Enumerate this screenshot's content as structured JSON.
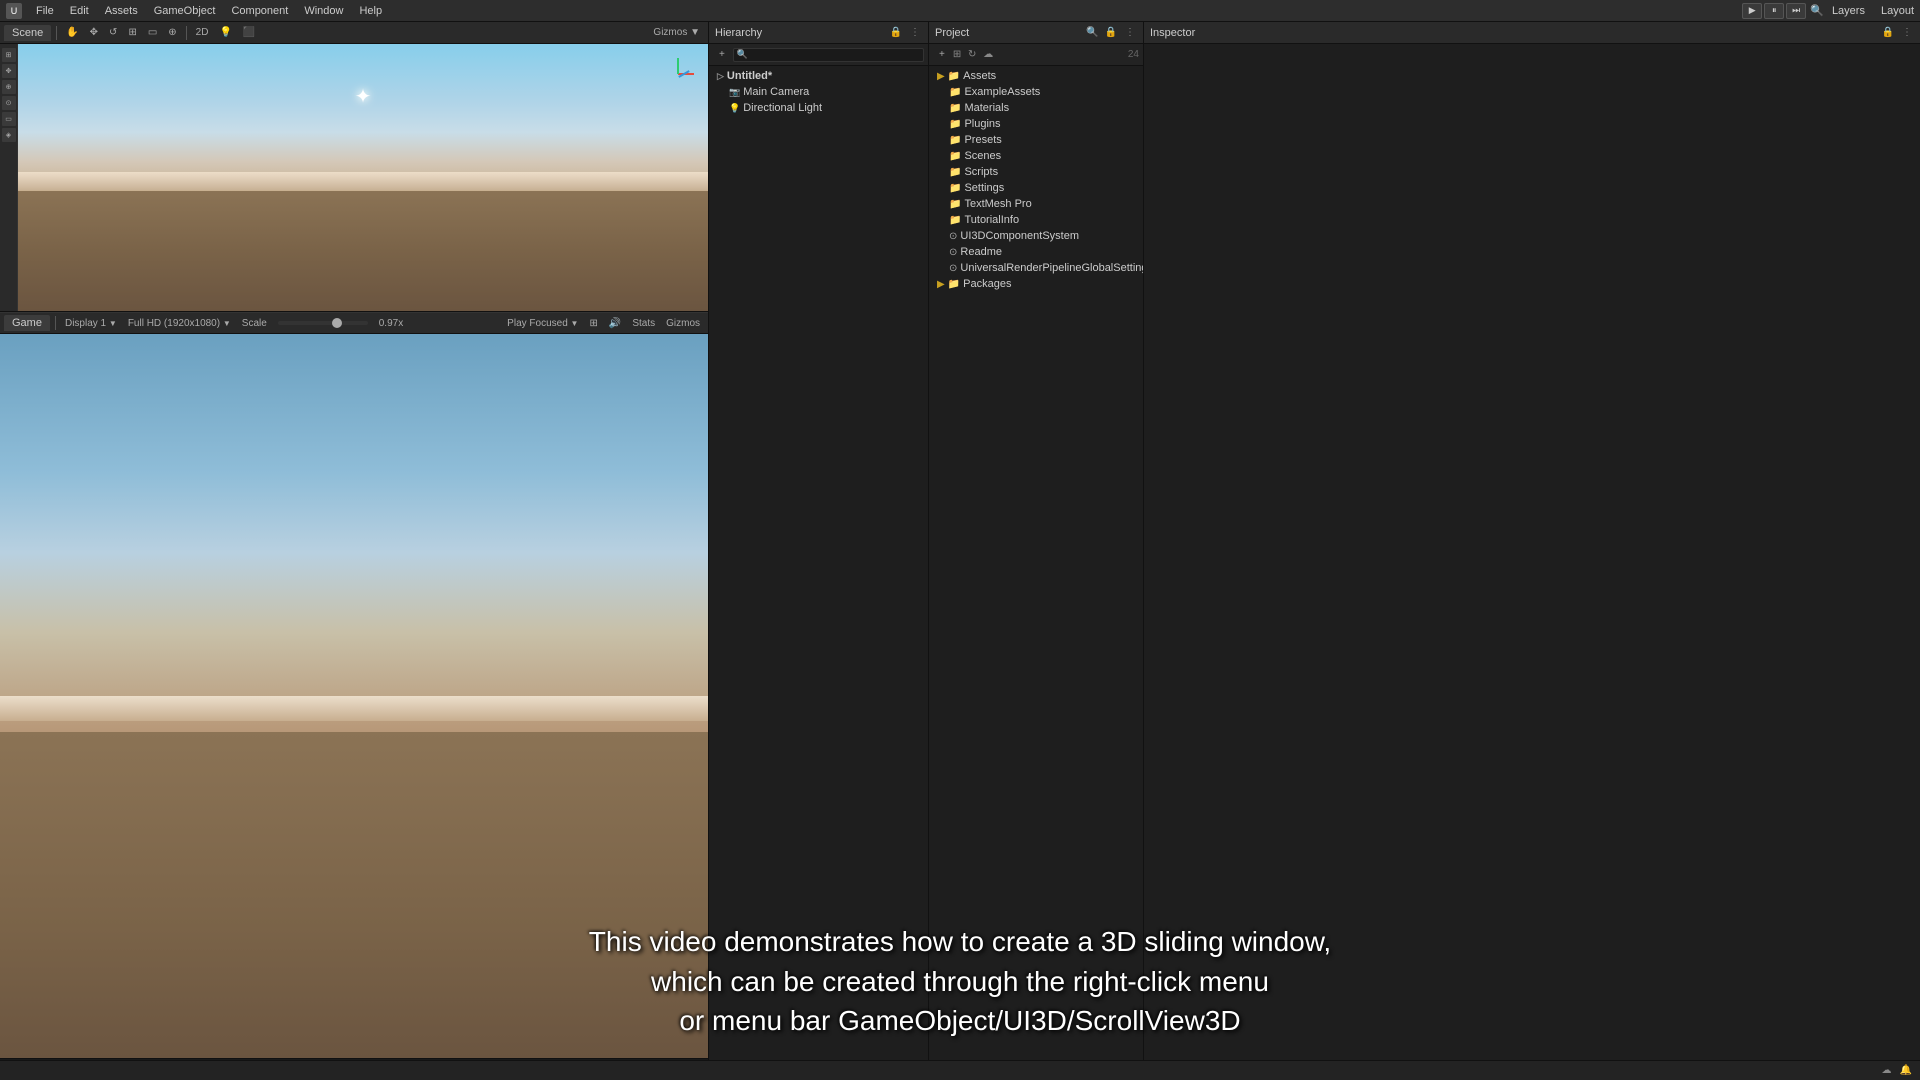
{
  "topbar": {
    "menus": [
      "File",
      "Edit",
      "Assets",
      "GameObject",
      "Component",
      "Window",
      "Help"
    ],
    "play_pause_label": "▶",
    "pause_label": "⏸",
    "step_label": "⏭",
    "layers_label": "Layers",
    "layout_label": "Layout",
    "search_icon": "🔍"
  },
  "scene_view": {
    "tab_label": "Scene",
    "toolbar_items": [
      "Hand",
      "Move",
      "Rotate",
      "Scale",
      "Rect",
      "Transform",
      "2D",
      "Lit",
      "Shaded"
    ],
    "tab_2d": "2D",
    "gizmo_label": "Gizmos ▼"
  },
  "game_view": {
    "tab_label": "Game",
    "display_label": "Display 1",
    "resolution_label": "Full HD (1920x1080)",
    "scale_label": "Scale",
    "scale_value": "0.97x",
    "play_focused_label": "Play Focused",
    "stats_label": "Stats",
    "gizmos_label": "Gizmos"
  },
  "hierarchy": {
    "title": "Hierarchy",
    "items": [
      {
        "label": "Untitled*",
        "indent": 0,
        "bold": true,
        "icon": "scene"
      },
      {
        "label": "Main Camera",
        "indent": 1,
        "bold": false,
        "icon": "camera"
      },
      {
        "label": "Directional Light",
        "indent": 1,
        "bold": false,
        "icon": "light"
      }
    ]
  },
  "project": {
    "title": "Project",
    "items": [
      {
        "label": "Assets",
        "indent": 0,
        "type": "folder"
      },
      {
        "label": "ExampleAssets",
        "indent": 1,
        "type": "folder"
      },
      {
        "label": "Materials",
        "indent": 1,
        "type": "folder"
      },
      {
        "label": "Plugins",
        "indent": 1,
        "type": "folder"
      },
      {
        "label": "Presets",
        "indent": 1,
        "type": "folder"
      },
      {
        "label": "Scenes",
        "indent": 1,
        "type": "folder"
      },
      {
        "label": "Scripts",
        "indent": 1,
        "type": "folder"
      },
      {
        "label": "Settings",
        "indent": 1,
        "type": "folder"
      },
      {
        "label": "TextMesh Pro",
        "indent": 1,
        "type": "folder"
      },
      {
        "label": "TutorialInfo",
        "indent": 1,
        "type": "folder"
      },
      {
        "label": "UI3DComponentSystem",
        "indent": 1,
        "type": "file"
      },
      {
        "label": "Readme",
        "indent": 1,
        "type": "file"
      },
      {
        "label": "UniversalRenderPipelineGlobalSettings",
        "indent": 1,
        "type": "file"
      },
      {
        "label": "Packages",
        "indent": 0,
        "type": "folder"
      }
    ]
  },
  "inspector": {
    "title": "Inspector"
  },
  "caption": {
    "line1": "This video demonstrates how to create a 3D sliding window,",
    "line2": "which can be created through the right-click menu",
    "line3": "or menu bar GameObject/UI3D/ScrollView3D"
  },
  "status_bar": {
    "icons": [
      "☁",
      "🔔"
    ]
  }
}
